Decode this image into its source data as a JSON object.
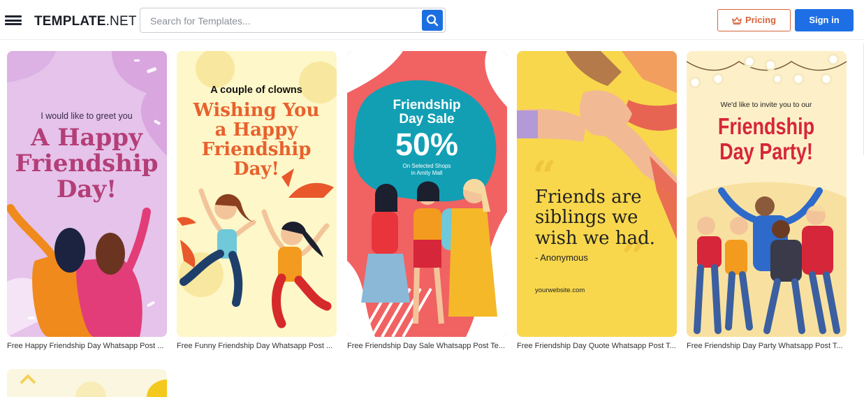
{
  "header": {
    "logo_bold": "TEMPLATE",
    "logo_rest": ".NET",
    "search_placeholder": "Search for Templates...",
    "pricing_label": "Pricing",
    "signin_label": "Sign in"
  },
  "cards": [
    {
      "caption": "Free Happy Friendship Day Whatsapp Post ...",
      "line1": "I would like to greet you",
      "line2": "A Happy",
      "line3": "Friendship",
      "line4": "Day!"
    },
    {
      "caption": "Free Funny Friendship Day Whatsapp Post ...",
      "line1": "A couple of clowns",
      "line2": "Wishing You",
      "line3": "a Happy",
      "line4": "Friendship",
      "line5": "Day!"
    },
    {
      "caption": "Free Friendship Day Sale Whatsapp Post Te...",
      "line1": "Friendship",
      "line2": "Day Sale",
      "line3": "50%",
      "line4": "On Selected Shops",
      "line5": "in Amity Mall"
    },
    {
      "caption": "Free Friendship Day Quote Whatsapp Post T...",
      "line1": "Friends are",
      "line2": "siblings we",
      "line3": "wish we had.",
      "line4": "- Anonymous",
      "line5": "yourwebsite.com"
    },
    {
      "caption": "Free Friendship Day Party Whatsapp Post T...",
      "line1": "We'd like to invite you to our",
      "line2": "Friendship",
      "line3": "Day Party!"
    }
  ],
  "icons": {
    "menu": "hamburger-menu-icon",
    "search": "search-icon",
    "pricing": "crown-icon"
  },
  "colors": {
    "brand_blue": "#1e6fe6",
    "pricing_orange": "#d6643a"
  }
}
